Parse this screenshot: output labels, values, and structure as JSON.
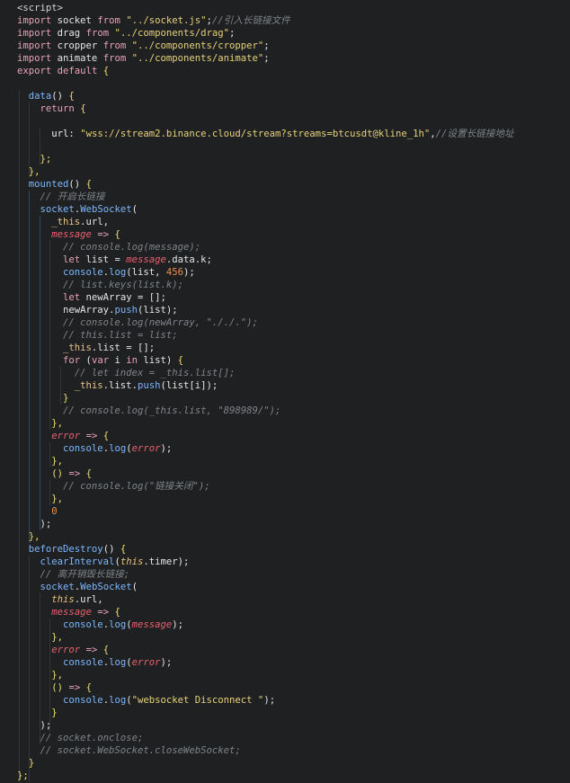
{
  "editor": {
    "colors": {
      "background": "#1f2022",
      "keyword": "#e8a3b5",
      "string": "#e6d27a",
      "comment": "#7f8489",
      "function": "#7cb7ff",
      "parameter": "#e8606f",
      "number": "#f08d49"
    },
    "lines": [
      [
        [
          "tag",
          "<script>"
        ]
      ],
      [
        [
          "kw",
          "import"
        ],
        [
          "plain",
          " socket "
        ],
        [
          "kw",
          "from"
        ],
        [
          "plain",
          " "
        ],
        [
          "str",
          "\"../socket.js\""
        ],
        [
          "plain",
          ";"
        ],
        [
          "com",
          "//引入长链接文件"
        ]
      ],
      [
        [
          "kw",
          "import"
        ],
        [
          "plain",
          " drag "
        ],
        [
          "kw",
          "from"
        ],
        [
          "plain",
          " "
        ],
        [
          "str",
          "\"../components/drag\""
        ],
        [
          "plain",
          ";"
        ]
      ],
      [
        [
          "kw",
          "import"
        ],
        [
          "plain",
          " cropper "
        ],
        [
          "kw",
          "from"
        ],
        [
          "plain",
          " "
        ],
        [
          "str",
          "\"../components/cropper\""
        ],
        [
          "plain",
          ";"
        ]
      ],
      [
        [
          "kw",
          "import"
        ],
        [
          "plain",
          " animate "
        ],
        [
          "kw",
          "from"
        ],
        [
          "plain",
          " "
        ],
        [
          "str",
          "\"../components/animate\""
        ],
        [
          "plain",
          ";"
        ]
      ],
      [
        [
          "kw",
          "export"
        ],
        [
          "plain",
          " "
        ],
        [
          "kw",
          "default"
        ],
        [
          "plain",
          " "
        ],
        [
          "punc",
          "{"
        ]
      ],
      [],
      [
        [
          "plain",
          "  "
        ],
        [
          "fn",
          "data"
        ],
        [
          "plain",
          "() "
        ],
        [
          "punc",
          "{"
        ]
      ],
      [
        [
          "plain",
          "    "
        ],
        [
          "kw",
          "return"
        ],
        [
          "plain",
          " "
        ],
        [
          "punc",
          "{"
        ]
      ],
      [],
      [
        [
          "plain",
          "      "
        ],
        [
          "prop",
          "url"
        ],
        [
          "plain",
          ": "
        ],
        [
          "str",
          "\"wss://stream2.binance.cloud/stream?streams=btcusdt@kline_1h\""
        ],
        [
          "plain",
          ","
        ],
        [
          "com",
          "//设置长链接地址"
        ]
      ],
      [],
      [
        [
          "plain",
          "    "
        ],
        [
          "punc",
          "};"
        ]
      ],
      [
        [
          "plain",
          "  "
        ],
        [
          "punc",
          "},"
        ]
      ],
      [
        [
          "plain",
          "  "
        ],
        [
          "fn",
          "mounted"
        ],
        [
          "plain",
          "() "
        ],
        [
          "punc",
          "{"
        ]
      ],
      [
        [
          "plain",
          "    "
        ],
        [
          "com",
          "// 开启长链接"
        ]
      ],
      [
        [
          "plain",
          "    "
        ],
        [
          "obj",
          "socket"
        ],
        [
          "plain",
          "."
        ],
        [
          "fn",
          "WebSocket"
        ],
        [
          "plain",
          "("
        ]
      ],
      [
        [
          "plain",
          "      "
        ],
        [
          "var",
          "_this"
        ],
        [
          "plain",
          ".url,"
        ]
      ],
      [
        [
          "plain",
          "      "
        ],
        [
          "param",
          "message"
        ],
        [
          "plain",
          " "
        ],
        [
          "kw",
          "=>"
        ],
        [
          "plain",
          " "
        ],
        [
          "punc",
          "{"
        ]
      ],
      [
        [
          "plain",
          "        "
        ],
        [
          "com",
          "// console.log(message);"
        ]
      ],
      [
        [
          "plain",
          "        "
        ],
        [
          "kw",
          "let"
        ],
        [
          "plain",
          " list = "
        ],
        [
          "param",
          "message"
        ],
        [
          "plain",
          ".data.k;"
        ]
      ],
      [
        [
          "plain",
          "        "
        ],
        [
          "obj",
          "console"
        ],
        [
          "plain",
          "."
        ],
        [
          "fn",
          "log"
        ],
        [
          "plain",
          "(list, "
        ],
        [
          "num",
          "456"
        ],
        [
          "plain",
          ");"
        ]
      ],
      [
        [
          "plain",
          "        "
        ],
        [
          "com",
          "// list.keys(list.k);"
        ]
      ],
      [
        [
          "plain",
          "        "
        ],
        [
          "kw",
          "let"
        ],
        [
          "plain",
          " newArray = [];"
        ]
      ],
      [
        [
          "plain",
          "        "
        ],
        [
          "plain",
          "newArray."
        ],
        [
          "fn",
          "push"
        ],
        [
          "plain",
          "(list);"
        ]
      ],
      [
        [
          "plain",
          "        "
        ],
        [
          "com",
          "// console.log(newArray, \"././.\");"
        ]
      ],
      [
        [
          "plain",
          "        "
        ],
        [
          "com",
          "// this.list = list;"
        ]
      ],
      [
        [
          "plain",
          "        "
        ],
        [
          "var",
          "_this"
        ],
        [
          "plain",
          ".list = [];"
        ]
      ],
      [
        [
          "plain",
          "        "
        ],
        [
          "kw",
          "for"
        ],
        [
          "plain",
          " ("
        ],
        [
          "kw",
          "var"
        ],
        [
          "plain",
          " i "
        ],
        [
          "kw",
          "in"
        ],
        [
          "plain",
          " list) "
        ],
        [
          "punc",
          "{"
        ]
      ],
      [
        [
          "plain",
          "          "
        ],
        [
          "com",
          "// let index = _this.list[];"
        ]
      ],
      [
        [
          "plain",
          "          "
        ],
        [
          "var",
          "_this"
        ],
        [
          "plain",
          ".list."
        ],
        [
          "fn",
          "push"
        ],
        [
          "plain",
          "(list[i]);"
        ]
      ],
      [
        [
          "plain",
          "        "
        ],
        [
          "punc",
          "}"
        ]
      ],
      [
        [
          "plain",
          "        "
        ],
        [
          "com",
          "// console.log(_this.list, \"898989/\");"
        ]
      ],
      [
        [
          "plain",
          "      "
        ],
        [
          "punc",
          "},"
        ]
      ],
      [
        [
          "plain",
          "      "
        ],
        [
          "param",
          "error"
        ],
        [
          "plain",
          " "
        ],
        [
          "kw",
          "=>"
        ],
        [
          "plain",
          " "
        ],
        [
          "punc",
          "{"
        ]
      ],
      [
        [
          "plain",
          "        "
        ],
        [
          "obj",
          "console"
        ],
        [
          "plain",
          "."
        ],
        [
          "fn",
          "log"
        ],
        [
          "plain",
          "("
        ],
        [
          "param",
          "error"
        ],
        [
          "plain",
          ");"
        ]
      ],
      [
        [
          "plain",
          "      "
        ],
        [
          "punc",
          "},"
        ]
      ],
      [
        [
          "plain",
          "      "
        ],
        [
          "punc",
          "()"
        ],
        [
          "plain",
          " "
        ],
        [
          "kw",
          "=>"
        ],
        [
          "plain",
          " "
        ],
        [
          "punc",
          "{"
        ]
      ],
      [
        [
          "plain",
          "        "
        ],
        [
          "com",
          "// console.log(\"链接关闭\");"
        ]
      ],
      [
        [
          "plain",
          "      "
        ],
        [
          "punc",
          "},"
        ]
      ],
      [
        [
          "plain",
          "      "
        ],
        [
          "num",
          "0"
        ]
      ],
      [
        [
          "plain",
          "    "
        ],
        [
          "plain",
          ");"
        ]
      ],
      [
        [
          "plain",
          "  "
        ],
        [
          "punc",
          "},"
        ]
      ],
      [
        [
          "plain",
          "  "
        ],
        [
          "fn",
          "beforeDestroy"
        ],
        [
          "plain",
          "() "
        ],
        [
          "punc",
          "{"
        ]
      ],
      [
        [
          "plain",
          "    "
        ],
        [
          "fn",
          "clearInterval"
        ],
        [
          "plain",
          "("
        ],
        [
          "this",
          "this"
        ],
        [
          "plain",
          ".timer);"
        ]
      ],
      [
        [
          "plain",
          "    "
        ],
        [
          "com",
          "// 离开销毁长链接;"
        ]
      ],
      [
        [
          "plain",
          "    "
        ],
        [
          "obj",
          "socket"
        ],
        [
          "plain",
          "."
        ],
        [
          "fn",
          "WebSocket"
        ],
        [
          "plain",
          "("
        ]
      ],
      [
        [
          "plain",
          "      "
        ],
        [
          "this",
          "this"
        ],
        [
          "plain",
          ".url,"
        ]
      ],
      [
        [
          "plain",
          "      "
        ],
        [
          "param",
          "message"
        ],
        [
          "plain",
          " "
        ],
        [
          "kw",
          "=>"
        ],
        [
          "plain",
          " "
        ],
        [
          "punc",
          "{"
        ]
      ],
      [
        [
          "plain",
          "        "
        ],
        [
          "obj",
          "console"
        ],
        [
          "plain",
          "."
        ],
        [
          "fn",
          "log"
        ],
        [
          "plain",
          "("
        ],
        [
          "param",
          "message"
        ],
        [
          "plain",
          ");"
        ]
      ],
      [
        [
          "plain",
          "      "
        ],
        [
          "punc",
          "},"
        ]
      ],
      [
        [
          "plain",
          "      "
        ],
        [
          "param",
          "error"
        ],
        [
          "plain",
          " "
        ],
        [
          "kw",
          "=>"
        ],
        [
          "plain",
          " "
        ],
        [
          "punc",
          "{"
        ]
      ],
      [
        [
          "plain",
          "        "
        ],
        [
          "obj",
          "console"
        ],
        [
          "plain",
          "."
        ],
        [
          "fn",
          "log"
        ],
        [
          "plain",
          "("
        ],
        [
          "param",
          "error"
        ],
        [
          "plain",
          ");"
        ]
      ],
      [
        [
          "plain",
          "      "
        ],
        [
          "punc",
          "},"
        ]
      ],
      [
        [
          "plain",
          "      "
        ],
        [
          "punc",
          "()"
        ],
        [
          "plain",
          " "
        ],
        [
          "kw",
          "=>"
        ],
        [
          "plain",
          " "
        ],
        [
          "punc",
          "{"
        ]
      ],
      [
        [
          "plain",
          "        "
        ],
        [
          "obj",
          "console"
        ],
        [
          "plain",
          "."
        ],
        [
          "fn",
          "log"
        ],
        [
          "plain",
          "("
        ],
        [
          "str",
          "\"websocket Disconnect \""
        ],
        [
          "plain",
          ");"
        ]
      ],
      [
        [
          "plain",
          "      "
        ],
        [
          "punc",
          "}"
        ]
      ],
      [
        [
          "plain",
          "    "
        ],
        [
          "plain",
          ");"
        ]
      ],
      [
        [
          "plain",
          "    "
        ],
        [
          "com",
          "// socket.onclose;"
        ]
      ],
      [
        [
          "plain",
          "    "
        ],
        [
          "com",
          "// socket.WebSocket.closeWebSocket;"
        ]
      ],
      [
        [
          "plain",
          "  "
        ],
        [
          "punc",
          "}"
        ]
      ],
      [
        [
          "punc",
          "};"
        ]
      ]
    ]
  }
}
